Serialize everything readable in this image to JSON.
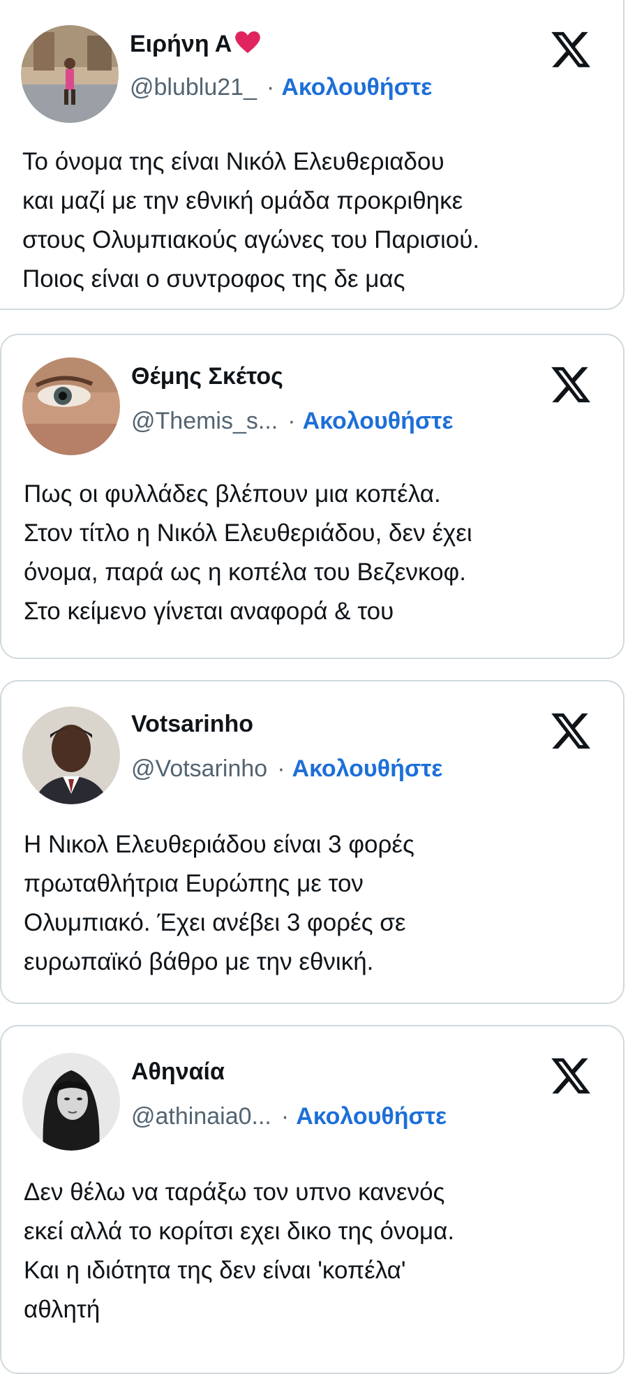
{
  "tweets": [
    {
      "name": "Ειρήνη Α",
      "handle": "@blublu21_",
      "separator": "·",
      "follow_label": "Ακολουθήστε",
      "lines": [
        "Το όνομα της είναι Νικόλ Ελευθεριαδου",
        "και μαζί με την εθνική ομάδα προκριθηκε",
        "στους Ολυμπιακούς αγώνες του Παρισιού.",
        "Ποιος είναι ο συντροφος της δε μας"
      ],
      "avatar_icon": "avatar-photo-outdoor",
      "has_heart_emoji": true
    },
    {
      "name": "Θέμης Σκέτος",
      "handle": "@Themis_s...",
      "separator": "·",
      "follow_label": "Ακολουθήστε",
      "lines": [
        "Πως οι φυλλάδες βλέπουν μια κοπέλα.",
        "Στον τίτλο η Νικόλ Ελευθεριάδου, δεν έχει",
        "όνομα, παρά ως η κοπέλα του Βεζενκοφ.",
        "Στο κείμενο γίνεται αναφορά & του"
      ],
      "avatar_icon": "avatar-photo-eye"
    },
    {
      "name": "Votsarinho",
      "handle": "@Votsarinho",
      "separator": "·",
      "follow_label": "Ακολουθήστε",
      "lines": [
        "Η Νικολ Ελευθεριάδου είναι 3 φορές",
        "πρωταθλήτρια Ευρώπης με τον",
        "Ολυμπιακό. Έχει ανέβει 3 φορές σε",
        "ευρωπαϊκό βάθρο με την εθνική."
      ],
      "avatar_icon": "avatar-photo-man-suit"
    },
    {
      "name": "Αθηναία",
      "handle": "@athinaia0...",
      "separator": "·",
      "follow_label": "Ακολουθήστε",
      "lines": [
        "Δεν θέλω να ταράξω τον υπνο κανενός",
        "εκεί αλλά το κορίτσι εχει δικο της όνομα.",
        "Και η ιδιότητα της δεν είναι 'κοπέλα'",
        "αθλητή"
      ],
      "avatar_icon": "avatar-photo-woman-bw"
    }
  ],
  "colors": {
    "follow": "#1d6fd8",
    "handle": "#536471",
    "text": "#0f1419",
    "border": "#cfd9de",
    "heart": "#e0245e"
  },
  "logo_icon": "x-logo-icon"
}
